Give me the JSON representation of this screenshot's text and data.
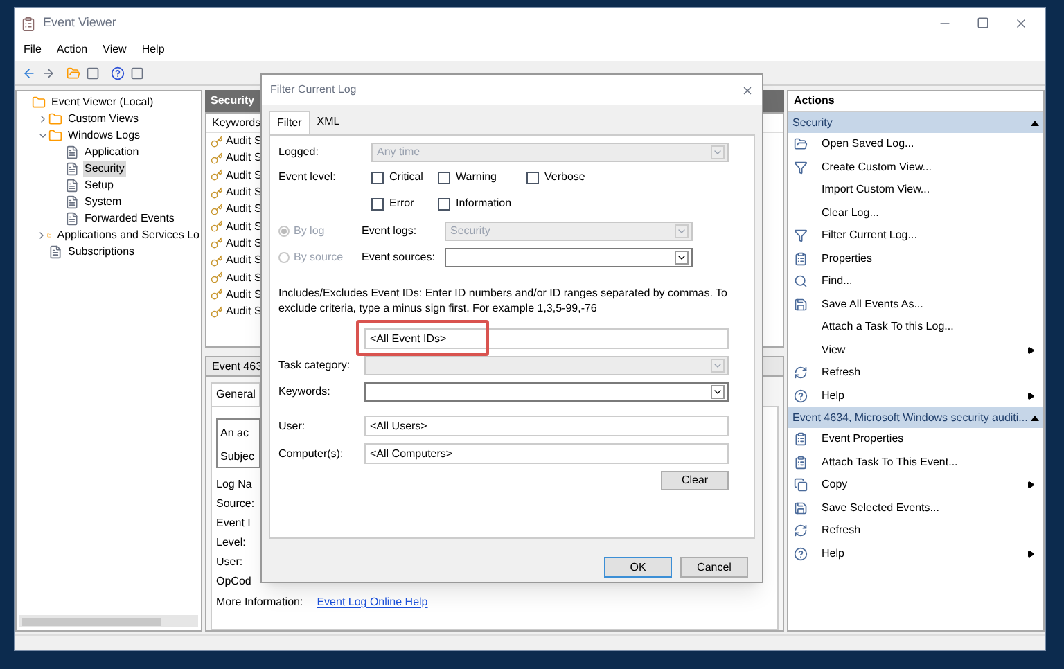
{
  "window": {
    "title": "Event Viewer"
  },
  "menu": [
    "File",
    "Action",
    "View",
    "Help"
  ],
  "tree": [
    {
      "label": "Event Viewer (Local)",
      "selected": false,
      "children": [
        {
          "label": "Custom Views",
          "selected": false,
          "expanded": false
        },
        {
          "label": "Windows Logs",
          "selected": false,
          "expanded": true,
          "children": [
            {
              "label": "Application",
              "selected": false
            },
            {
              "label": "Security",
              "selected": true
            },
            {
              "label": "Setup",
              "selected": false
            },
            {
              "label": "System",
              "selected": false
            },
            {
              "label": "Forwarded Events",
              "selected": false
            }
          ]
        },
        {
          "label": "Applications and Services Lo",
          "selected": false,
          "expanded": false
        },
        {
          "label": "Subscriptions",
          "selected": false
        }
      ]
    }
  ],
  "log_pane": {
    "title": "Security",
    "columns": [
      "Keywords"
    ],
    "rows": [
      "Audit S",
      "Audit S",
      "Audit S",
      "Audit S",
      "Audit S",
      "Audit S",
      "Audit S",
      "Audit S",
      "Audit S",
      "Audit S",
      "Audit S"
    ]
  },
  "event_detail": {
    "title": "Event 463",
    "tabs": [
      {
        "label": "General",
        "selected": true
      }
    ],
    "description": [
      "An ac",
      "Subjec"
    ],
    "fields": [
      "Log Na",
      "Source:",
      "Event I",
      "Level:",
      "User:",
      "OpCod"
    ],
    "more_info": {
      "label": "More Information:",
      "link": "Event Log Online Help"
    }
  },
  "actions": {
    "title": "Actions",
    "sections": [
      {
        "title": "Security",
        "expanded": true,
        "items": [
          {
            "label": "Open Saved Log...",
            "submenu": false
          },
          {
            "label": "Create Custom View...",
            "submenu": false
          },
          {
            "label": "Import Custom View...",
            "submenu": false
          },
          {
            "label": "Clear Log...",
            "submenu": false
          },
          {
            "label": "Filter Current Log...",
            "submenu": false
          },
          {
            "label": "Properties",
            "submenu": false
          },
          {
            "label": "Find...",
            "submenu": false
          },
          {
            "label": "Save All Events As...",
            "submenu": false
          },
          {
            "label": "Attach a Task To this Log...",
            "submenu": false
          },
          {
            "label": "View",
            "submenu": true
          },
          {
            "label": "Refresh",
            "submenu": false
          },
          {
            "label": "Help",
            "submenu": true
          }
        ]
      },
      {
        "title": "Event 4634, Microsoft Windows security auditi...",
        "expanded": true,
        "items": [
          {
            "label": "Event Properties",
            "submenu": false
          },
          {
            "label": "Attach Task To This Event...",
            "submenu": false
          },
          {
            "label": "Copy",
            "submenu": true
          },
          {
            "label": "Save Selected Events...",
            "submenu": false
          },
          {
            "label": "Refresh",
            "submenu": false
          },
          {
            "label": "Help",
            "submenu": true
          }
        ]
      }
    ]
  },
  "dialog": {
    "title": "Filter Current Log",
    "tabs": [
      {
        "label": "Filter",
        "selected": true
      },
      {
        "label": "XML",
        "selected": false
      }
    ],
    "logged": {
      "label": "Logged:",
      "value": "Any time"
    },
    "event_level": {
      "label": "Event level:",
      "options": [
        {
          "label": "Critical",
          "checked": false
        },
        {
          "label": "Warning",
          "checked": false
        },
        {
          "label": "Verbose",
          "checked": false
        },
        {
          "label": "Error",
          "checked": false
        },
        {
          "label": "Information",
          "checked": false
        }
      ]
    },
    "source_mode": {
      "disabled": true,
      "options": [
        {
          "label": "By log",
          "selected": true
        },
        {
          "label": "By source",
          "selected": false
        }
      ]
    },
    "event_logs": {
      "label": "Event logs:",
      "value": "Security",
      "disabled": true
    },
    "event_sources": {
      "label": "Event sources:",
      "disabled": false
    },
    "help_text": "Includes/Excludes Event IDs: Enter ID numbers and/or ID ranges separated by commas. To exclude criteria, type a minus sign first. For example 1,3,5-99,-76",
    "event_ids": {
      "value": "<All Event IDs>",
      "highlighted": true
    },
    "task_category": {
      "label": "Task category:",
      "disabled": true
    },
    "keywords": {
      "label": "Keywords:",
      "disabled": false
    },
    "user": {
      "label": "User:",
      "value": "<All Users>"
    },
    "computers": {
      "label": "Computer(s):",
      "value": "<All Computers>"
    },
    "buttons": {
      "clear": "Clear",
      "ok": "OK",
      "cancel": "Cancel"
    }
  }
}
